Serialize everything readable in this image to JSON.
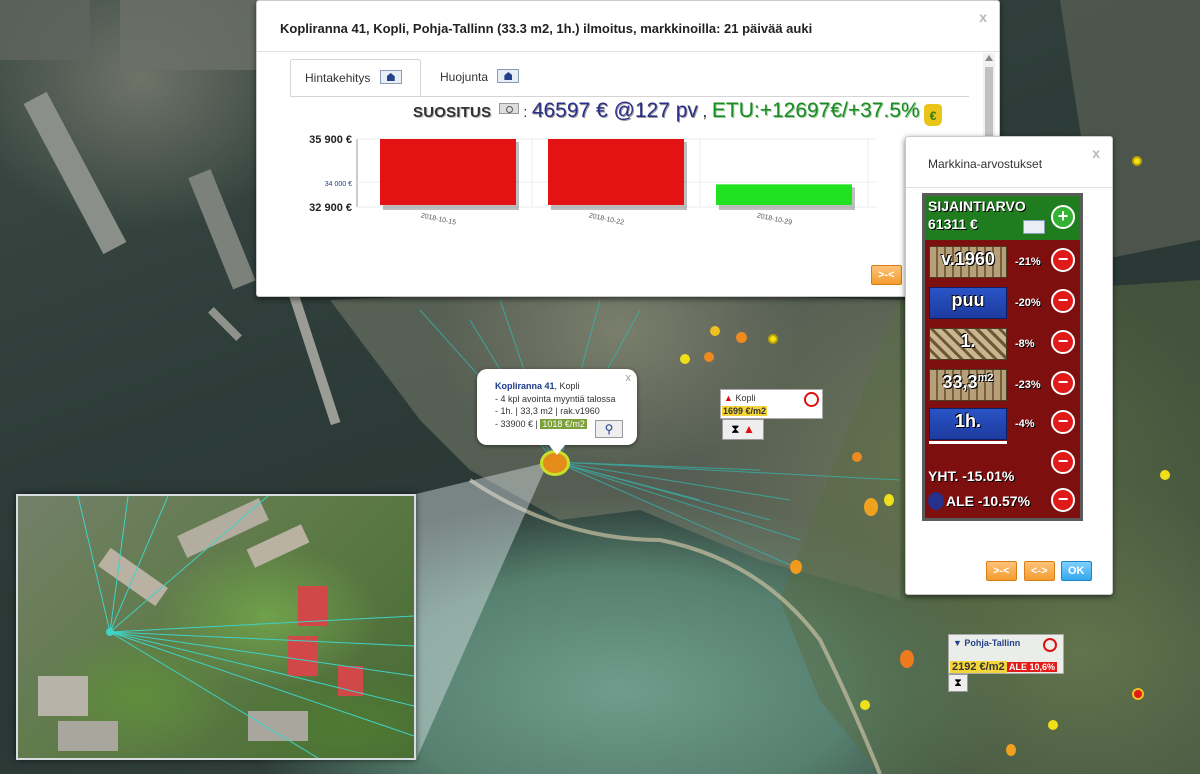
{
  "listing_dialog": {
    "title": "Kopliranna 41, Kopli, Pohja-Tallinn (33.3 m2, 1h.) ilmoitus, markkinoilla: 21 päivää auki",
    "close": "x",
    "tabs": [
      {
        "label": "Hintakehitys",
        "icon": "house-chart-icon",
        "active": true
      },
      {
        "label": "Huojunta",
        "icon": "house-chart-icon",
        "active": false
      }
    ],
    "suositus_label": "SUOSITUS",
    "suositus_colon": ":",
    "suositus_value": "46597 € @127 pv",
    "suositus_comma": ",",
    "etu_value": "ETU:+12697€/+37.5%",
    "money_icon": "money-bag-icon",
    "collapse_button": ">-<"
  },
  "chart_data": {
    "type": "bar",
    "categories": [
      "2018-10-15",
      "2018-10-22",
      "2018-10-29"
    ],
    "values": [
      35900,
      35900,
      33900
    ],
    "colors": [
      "#e31313",
      "#e31313",
      "#21e221"
    ],
    "ytick_labels": [
      "35 900 €",
      "34 000 €",
      "32 900 €"
    ],
    "ytick_values": [
      35900,
      34000,
      32900
    ],
    "ylim": [
      32900,
      35900
    ],
    "grid": true
  },
  "market_dialog": {
    "title": "Markkina-arvostukset",
    "close": "x",
    "location_label": "SIJAINTIARVO",
    "location_value": "61311 €",
    "rows": [
      {
        "icon_text": "v.1960",
        "percent": "-21%",
        "icon": "building-year-icon"
      },
      {
        "icon_text": "puu",
        "percent": "-20%",
        "icon": "wood-material-icon"
      },
      {
        "icon_text": "1.",
        "percent": "-8%",
        "icon": "floor-icon"
      },
      {
        "icon_text": "33,3",
        "icon_sup": "m2",
        "percent": "-23%",
        "icon": "area-icon"
      },
      {
        "icon_text": "1h.",
        "percent": "-4%",
        "icon": "rooms-icon"
      }
    ],
    "total": "YHT. -15.01%",
    "discount": "ALE -10.57%",
    "buttons": {
      "collapse": ">-<",
      "expand": "<->",
      "ok": "OK"
    }
  },
  "popup": {
    "address": "Kopliranna 41",
    "district": ", Kopli",
    "line1": "- 4 kpl avointa myyntiä talossa",
    "line2": "- 1h. | 33,3 m2 | rak.v1960",
    "line3": "- 33900 € |",
    "price_per_m2": "1018 €/m2",
    "close": "x"
  },
  "district_labels": {
    "kopli": {
      "name": "Kopli",
      "price": "1699 €/m2"
    },
    "pohja_tallinn": {
      "name": "Pohja-Tallinn",
      "price": "2192 €/m2",
      "ale": "ALE 10,6%"
    }
  }
}
